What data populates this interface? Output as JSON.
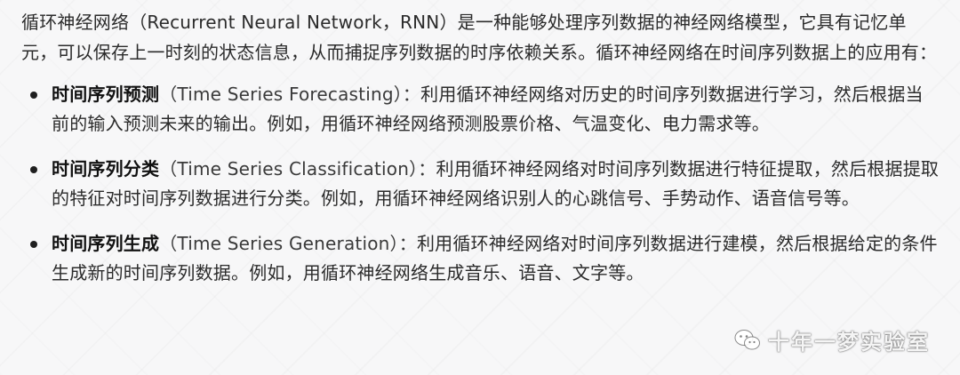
{
  "intro": "循环神经网络（Recurrent Neural Network，RNN）是一种能够处理序列数据的神经网络模型，它具有记忆单元，可以保存上一时刻的状态信息，从而捕捉序列数据的时序依赖关系。循环神经网络在时间序列数据上的应用有：",
  "items": [
    {
      "term": "时间序列预测",
      "en": "（Time Series Forecasting）：",
      "desc": "利用循环神经网络对历史的时间序列数据进行学习，然后根据当前的输入预测未来的输出。例如，用循环神经网络预测股票价格、气温变化、电力需求等。"
    },
    {
      "term": "时间序列分类",
      "en": "（Time Series Classification）：",
      "desc": "利用循环神经网络对时间序列数据进行特征提取，然后根据提取的特征对时间序列数据进行分类。例如，用循环神经网络识别人的心跳信号、手势动作、语音信号等。"
    },
    {
      "term": "时间序列生成",
      "en": "（Time Series Generation）：",
      "desc": "利用循环神经网络对时间序列数据进行建模，然后根据给定的条件生成新的时间序列数据。例如，用循环神经网络生成音乐、语音、文字等。"
    }
  ],
  "watermark": {
    "icon": "wechat-icon",
    "text": "十年一梦实验室"
  }
}
